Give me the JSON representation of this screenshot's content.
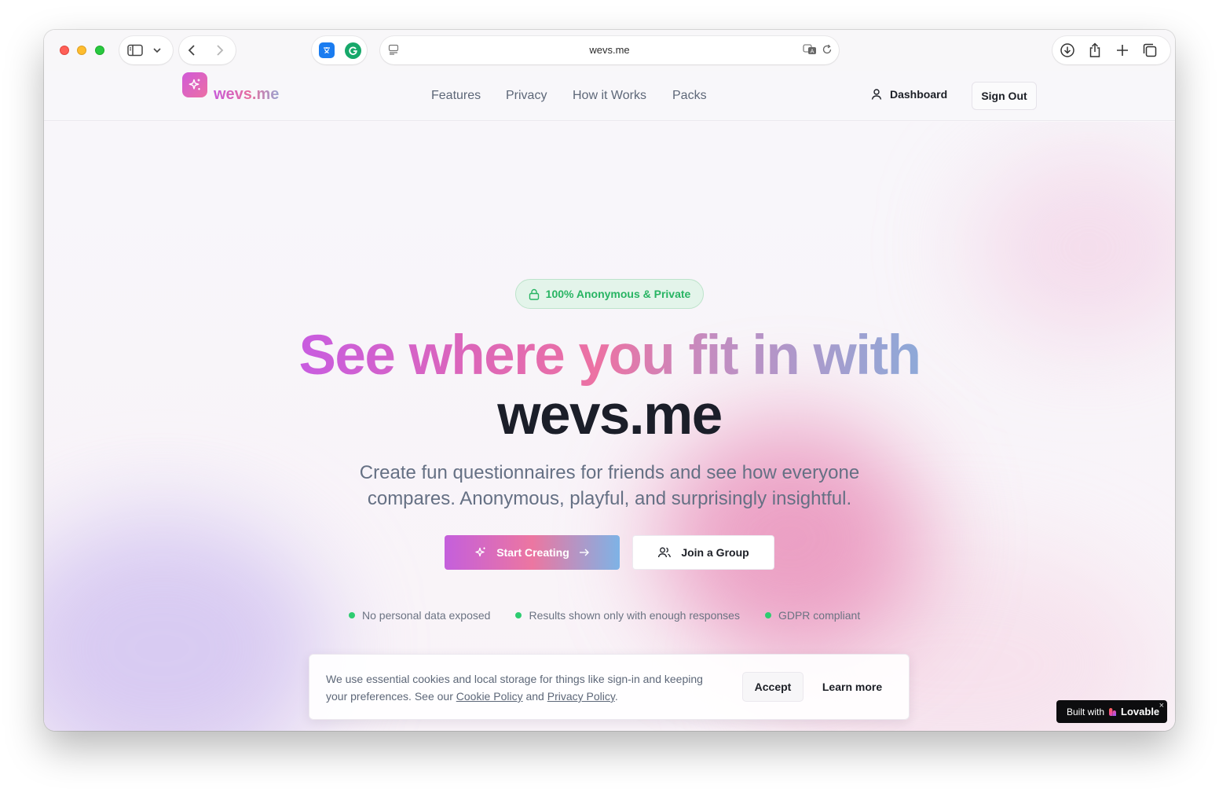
{
  "browser": {
    "url": "wevs.me"
  },
  "nav": {
    "brand": "wevs.me",
    "links": [
      "Features",
      "Privacy",
      "How it Works",
      "Packs"
    ],
    "dashboard_label": "Dashboard",
    "signout_label": "Sign Out"
  },
  "hero": {
    "badge": "100% Anonymous & Private",
    "title_line1": "See where you fit in with",
    "title_line2": "wevs.me",
    "subtitle": "Create fun questionnaires for friends and see how everyone compares. Anonymous, playful, and surprisingly insightful.",
    "primary_cta": "Start Creating",
    "secondary_cta": "Join a Group",
    "features": [
      "No personal data exposed",
      "Results shown only with enough responses",
      "GDPR compliant"
    ]
  },
  "cookie": {
    "text_before": "We use essential cookies and local storage for things like sign-in and keeping your preferences. See our",
    "cookie_link": "Cookie Policy",
    "and": "and",
    "privacy_link": "Privacy Policy",
    "period": ".",
    "accept_label": "Accept",
    "learn_label": "Learn more"
  },
  "lovable": {
    "prefix": "Built with",
    "name": "Lovable",
    "close": "×"
  },
  "colors": {
    "accent_pink": "#ec72a3",
    "accent_purple": "#c85ce0",
    "accent_blue": "#8ea9d8",
    "success_green": "#28b463"
  }
}
